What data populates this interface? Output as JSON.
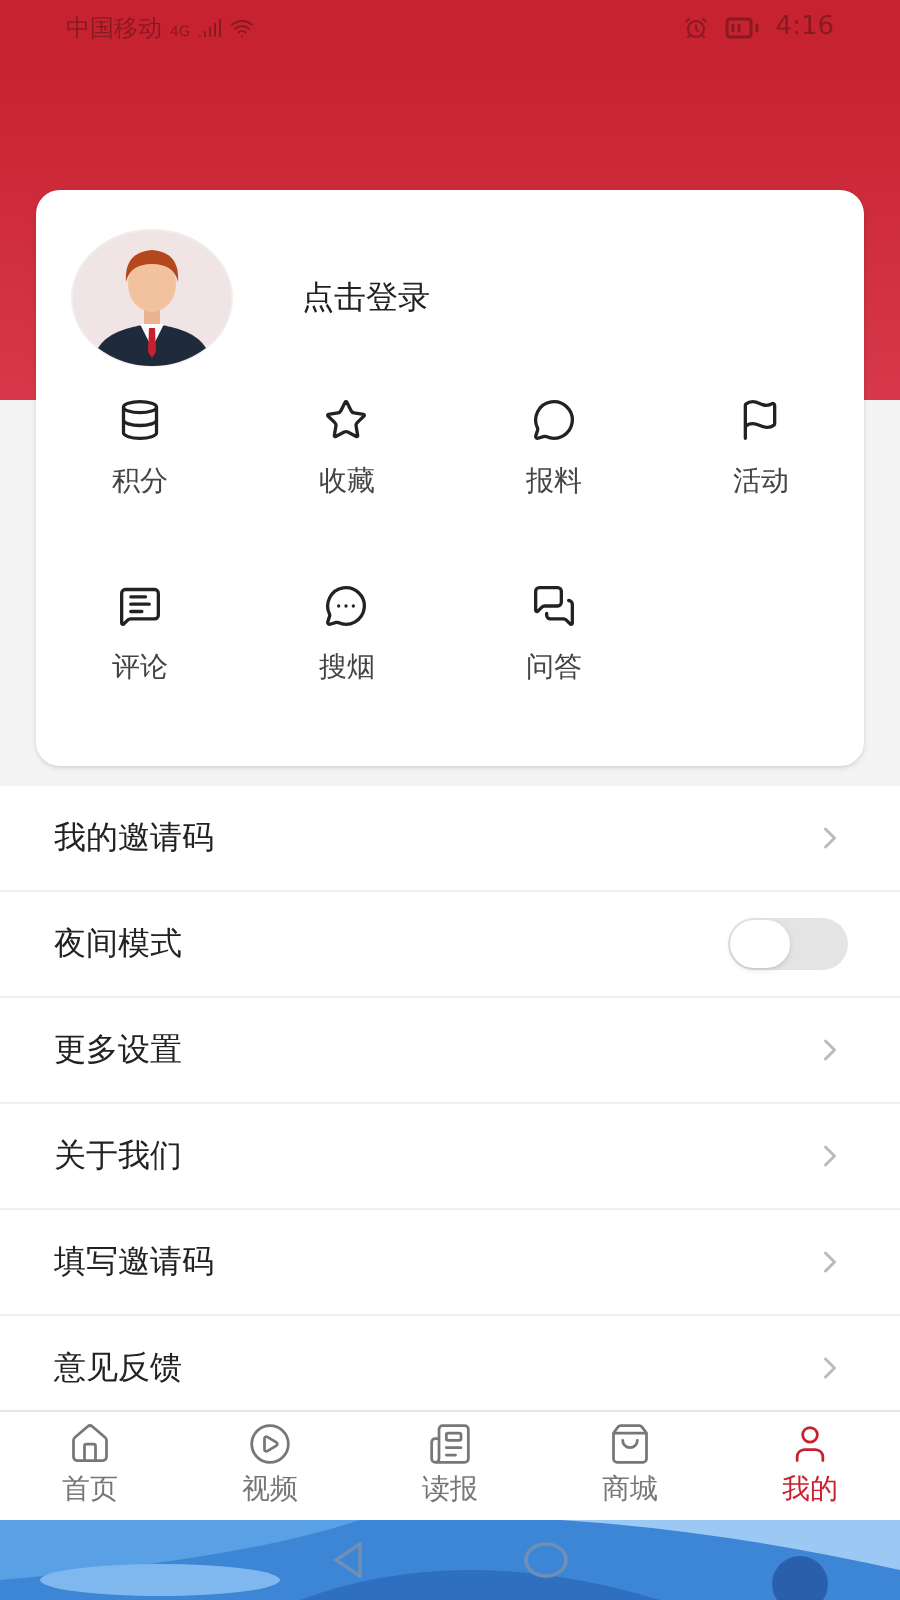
{
  "status_bar": {
    "carrier": "中国移动",
    "network": "4G",
    "time": "4:16"
  },
  "profile": {
    "login_text": "点击登录"
  },
  "shortcuts": [
    {
      "label": "积分"
    },
    {
      "label": "收藏"
    },
    {
      "label": "报料"
    },
    {
      "label": "活动"
    },
    {
      "label": "评论"
    },
    {
      "label": "搜烟"
    },
    {
      "label": "问答"
    }
  ],
  "settings": [
    {
      "label": "我的邀请码",
      "kind": "link"
    },
    {
      "label": "夜间模式",
      "kind": "toggle",
      "on": false
    },
    {
      "label": "更多设置",
      "kind": "link"
    },
    {
      "label": "关于我们",
      "kind": "link"
    },
    {
      "label": "填写邀请码",
      "kind": "link"
    },
    {
      "label": "意见反馈",
      "kind": "link"
    }
  ],
  "tab_bar": [
    {
      "label": "首页",
      "selected": false
    },
    {
      "label": "视频",
      "selected": false
    },
    {
      "label": "读报",
      "selected": false
    },
    {
      "label": "商城",
      "selected": false
    },
    {
      "label": "我的",
      "selected": true
    }
  ]
}
